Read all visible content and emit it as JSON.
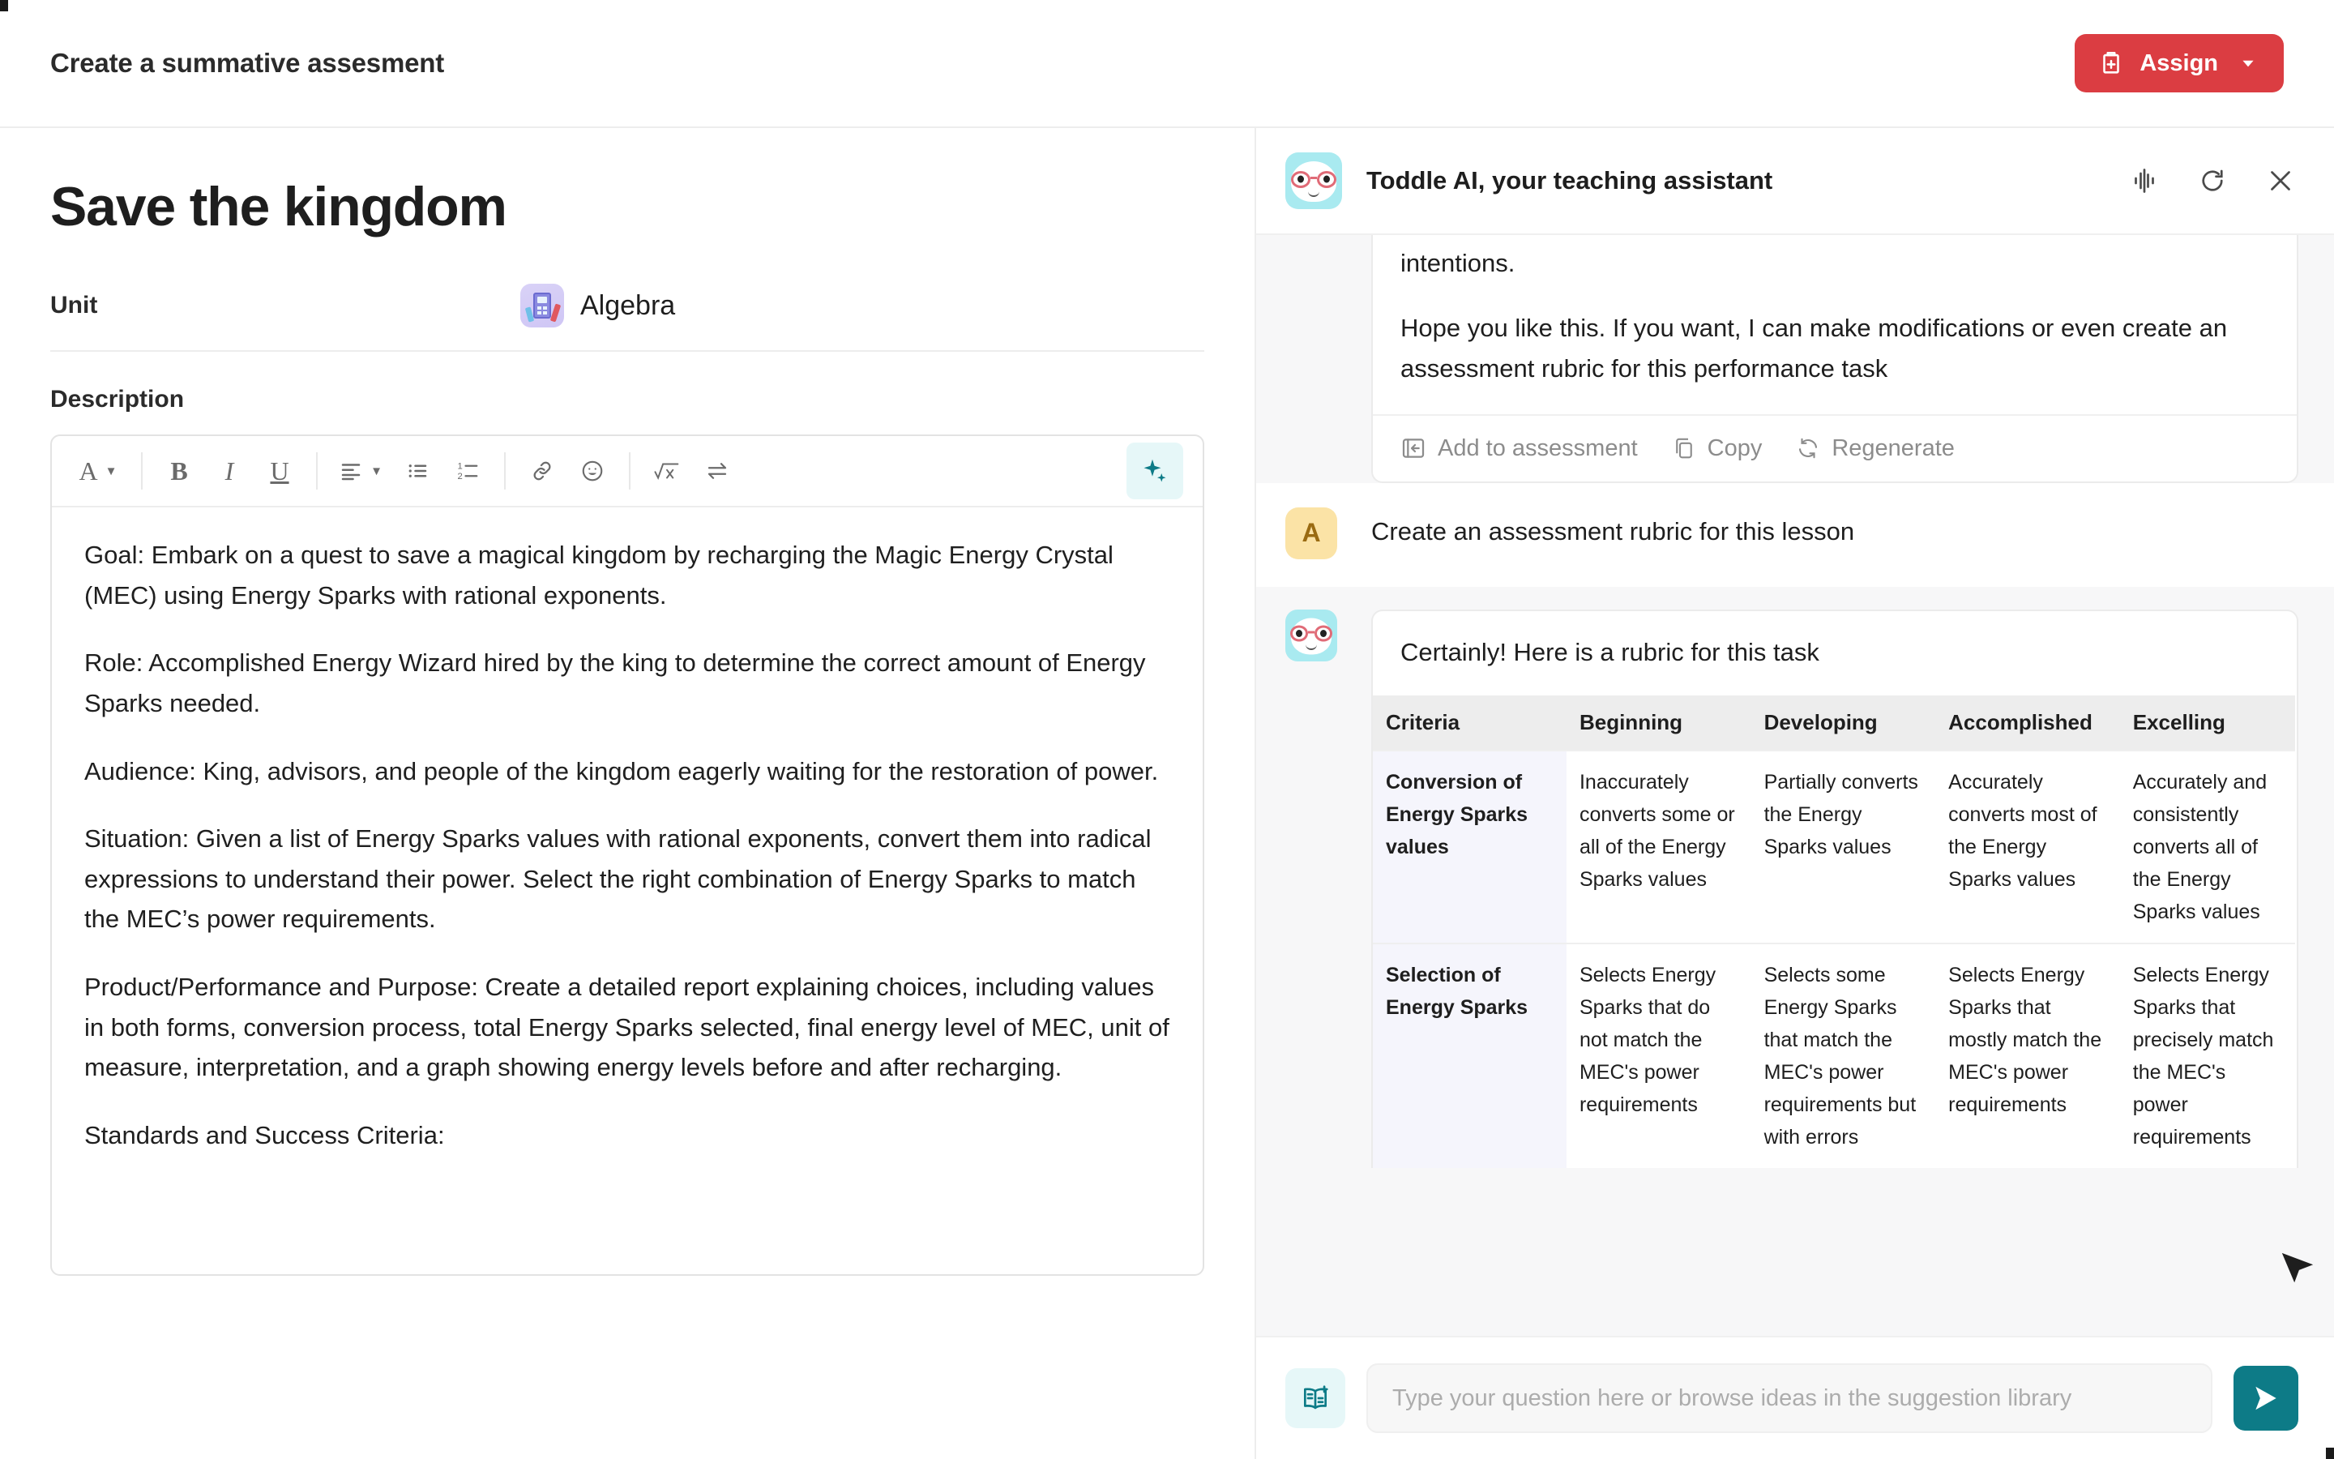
{
  "topbar": {
    "title": "Create a summative assesment",
    "assign_label": "Assign",
    "assign_color": "#DB3D42",
    "assign_icon": "clipboard-plus-icon",
    "assign_caret": "chevron-down-icon"
  },
  "document": {
    "title": "Save the kingdom",
    "unit_label": "Unit",
    "unit_value": "Algebra",
    "unit_icon": "calculator-icon",
    "description_label": "Description",
    "toolbar": [
      {
        "name": "text-style",
        "glyph": "A",
        "caret": true
      },
      {
        "name": "bold",
        "glyph": "B",
        "caret": false
      },
      {
        "name": "italic",
        "glyph": "I",
        "caret": false
      },
      {
        "name": "underline",
        "glyph": "U",
        "caret": false
      },
      {
        "name": "align",
        "glyph": "align-left-icon",
        "caret": true
      },
      {
        "name": "bulleted-list",
        "glyph": "bullet-list-icon",
        "caret": false
      },
      {
        "name": "numbered-list",
        "glyph": "numbered-list-icon",
        "caret": false
      },
      {
        "name": "link",
        "glyph": "link-icon",
        "caret": false
      },
      {
        "name": "emoji",
        "glyph": "emoji-icon",
        "caret": false
      },
      {
        "name": "math",
        "glyph": "sqrt-x-icon",
        "caret": false
      },
      {
        "name": "swap",
        "glyph": "swap-arrows-icon",
        "caret": false
      },
      {
        "name": "ai-assist",
        "glyph": "sparkle-icon",
        "caret": false
      }
    ],
    "ai_accent": "#0D7B87",
    "ai_accent_bg": "#E6F7F8",
    "paragraphs": [
      "Goal: Embark on a quest to save a magical kingdom by recharging the Magic Energy Crystal (MEC) using Energy Sparks with rational exponents.",
      "Role: Accomplished Energy Wizard hired by the king to determine the correct amount of Energy Sparks needed.",
      "Audience: King, advisors, and people of the kingdom eagerly waiting for the restoration of power.",
      "Situation: Given a list of Energy Sparks values with rational exponents, convert them into radical expressions to understand their power. Select the right combination of Energy Sparks to match the MEC’s power requirements.",
      "Product/Performance and Purpose: Create a detailed report explaining choices, including values in both forms, conversion process, total Energy Sparks selected, final energy level of MEC, unit of measure, interpretation, and a graph showing energy levels before and after recharging.",
      "Standards and Success Criteria:"
    ]
  },
  "ai_panel": {
    "title": "Toddle AI, your teaching assistant",
    "avatar_icon": "bot-glasses-avatar-icon",
    "header_icons": [
      {
        "name": "voice-waveform-icon"
      },
      {
        "name": "refresh-icon"
      },
      {
        "name": "close-icon"
      }
    ],
    "messages": {
      "first_assistant": {
        "paragraph_partial": "intentions.",
        "paragraph_2": "Hope you like this. If you want, I can make modifications or even create an assessment rubric for this performance task",
        "actions": [
          {
            "name": "add-to-assessment",
            "label": "Add to assessment",
            "icon": "add-to-assessment-icon"
          },
          {
            "name": "copy",
            "label": "Copy",
            "icon": "copy-icon"
          },
          {
            "name": "regenerate",
            "label": "Regenerate",
            "icon": "regenerate-icon"
          }
        ]
      },
      "user": {
        "initial": "A",
        "text": "Create an assessment rubric for this lesson"
      },
      "second_assistant": {
        "intro": "Certainly! Here is a rubric for this task"
      }
    },
    "rubric": {
      "headers": [
        "Criteria",
        "Beginning",
        "Developing",
        "Accomplished",
        "Excelling"
      ],
      "rows": [
        {
          "criteria": "Conversion of Energy Sparks values",
          "cells": [
            "Inaccurately converts some or all of the Energy Sparks values",
            "Partially converts the Energy Sparks values",
            "Accurately converts most of the Energy Sparks values",
            "Accurately and consistently converts all of the Energy Sparks values"
          ]
        },
        {
          "criteria": "Selection of Energy Sparks",
          "cells": [
            "Selects Energy Sparks that do not match the MEC's power requirements",
            "Selects some Energy Sparks that match the MEC's power requirements but with errors",
            "Selects Energy Sparks that mostly match the MEC's power requirements",
            "Selects Energy Sparks that precisely match the MEC's power requirements"
          ]
        }
      ]
    },
    "composer": {
      "library_icon": "suggestion-library-icon",
      "placeholder": "Type your question here or browse ideas in the suggestion library",
      "value": "",
      "send_icon": "send-icon",
      "send_color": "#0D7B87"
    }
  }
}
